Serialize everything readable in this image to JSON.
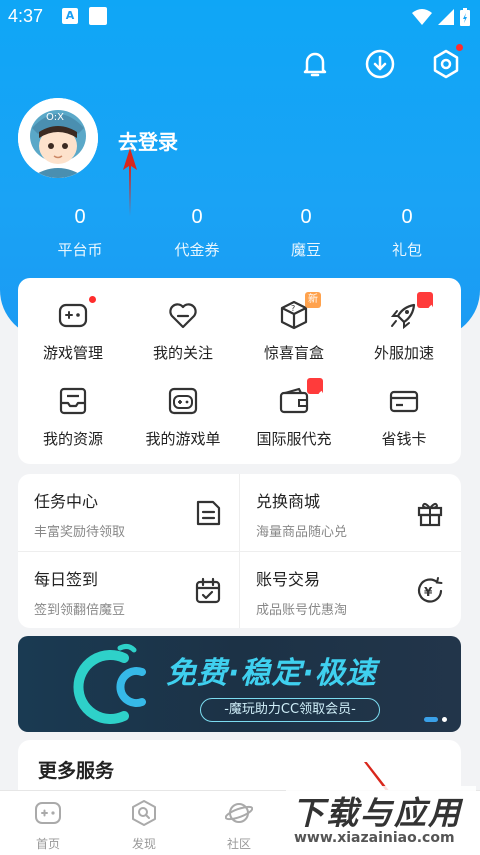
{
  "status_bar": {
    "time": "4:37",
    "a_icon": "A"
  },
  "profile": {
    "login_text": "去登录"
  },
  "stats": [
    {
      "value": "0",
      "label": "平台币"
    },
    {
      "value": "0",
      "label": "代金券"
    },
    {
      "value": "0",
      "label": "魔豆"
    },
    {
      "value": "0",
      "label": "礼包"
    }
  ],
  "grid": [
    {
      "label": "游戏管理",
      "icon": "gamepad-icon",
      "badge": "dot"
    },
    {
      "label": "我的关注",
      "icon": "heart-icon",
      "badge": ""
    },
    {
      "label": "惊喜盲盒",
      "icon": "mystery-box-icon",
      "badge": "新"
    },
    {
      "label": "外服加速",
      "icon": "rocket-icon",
      "badge": "hot"
    },
    {
      "label": "我的资源",
      "icon": "inbox-icon",
      "badge": ""
    },
    {
      "label": "我的游戏单",
      "icon": "game-list-icon",
      "badge": ""
    },
    {
      "label": "国际服代充",
      "icon": "wallet-icon",
      "badge": "hot"
    },
    {
      "label": "省钱卡",
      "icon": "card-icon",
      "badge": ""
    }
  ],
  "tasks": [
    {
      "title": "任务中心",
      "subtitle": "丰富奖励待领取",
      "icon": "task-icon"
    },
    {
      "title": "兑换商城",
      "subtitle": "海量商品随心兑",
      "icon": "gift-icon"
    },
    {
      "title": "每日签到",
      "subtitle": "签到领翻倍魔豆",
      "icon": "calendar-check-icon"
    },
    {
      "title": "账号交易",
      "subtitle": "成品账号优惠淘",
      "icon": "yen-exchange-icon"
    }
  ],
  "banner": {
    "title": "免费·稳定·极速",
    "subtitle": "-魔玩助力CC领取会员-"
  },
  "more_services": {
    "title": "更多服务"
  },
  "tabbar": [
    {
      "label": "首页",
      "icon": "home-gamepad-icon"
    },
    {
      "label": "发现",
      "icon": "discover-icon"
    },
    {
      "label": "社区",
      "icon": "planet-icon"
    }
  ],
  "watermark": {
    "title": "下载与应用",
    "url": "www.xiazainiao.com"
  },
  "colors": {
    "primary": "#1aa3f5",
    "accent_red": "#ff2d2d",
    "banner_text": "#3fd0ef"
  }
}
